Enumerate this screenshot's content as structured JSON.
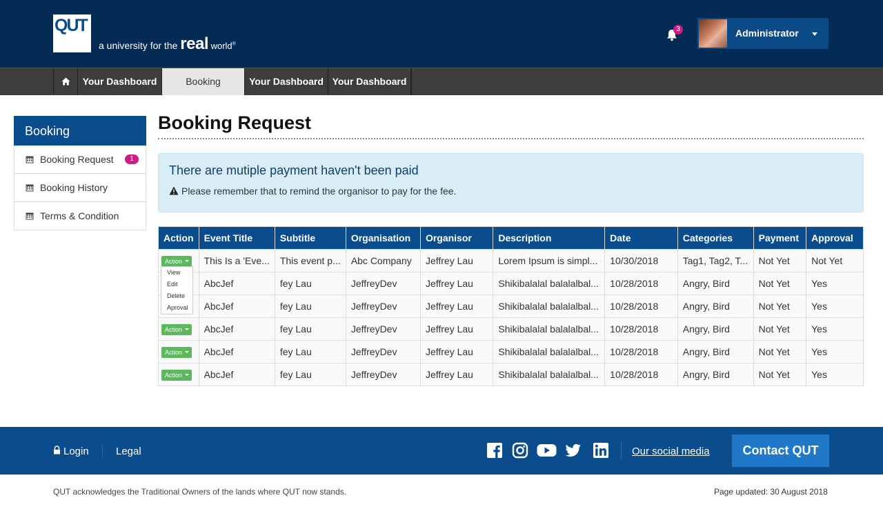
{
  "header": {
    "logo_text": "QUT",
    "tagline_prefix": "a university for the ",
    "tagline_real": "real",
    "tagline_world": " world",
    "tagline_reg": "®",
    "notifications_count": "3",
    "user_name": "Administrator"
  },
  "nav": {
    "items": [
      {
        "label": "Your Dashboard"
      },
      {
        "label": "Booking",
        "active": true
      },
      {
        "label": "Your Dashboard"
      },
      {
        "label": "Your Dashboard"
      }
    ]
  },
  "sidebar": {
    "title": "Booking",
    "items": [
      {
        "label": "Booking Request",
        "badge": "1"
      },
      {
        "label": "Booking History"
      },
      {
        "label": "Terms & Condition"
      }
    ]
  },
  "main": {
    "title": "Booking Request",
    "alert": {
      "heading": "There are mutiple payment haven't been paid",
      "message": "Please remember that to remind the organisor to pay for the fee."
    },
    "table": {
      "columns": [
        "Action",
        "Event Title",
        "Subtitle",
        "Organisation",
        "Organisor",
        "Description",
        "Date",
        "Categories",
        "Payment",
        "Approval"
      ],
      "action_label": "Action",
      "rows": [
        [
          "This Is a 'Eve...",
          "This event p...",
          "Abc Company",
          "Jeffrey Lau",
          "Lorem Ipsum is simpl...",
          "10/30/2018",
          "Tag1, Tag2, T...",
          "Not Yet",
          "Not Yet"
        ],
        [
          "AbcJef",
          "fey Lau",
          "JeffreyDev",
          "Jeffrey Lau",
          "Shikibalalal balalalbal...",
          "10/28/2018",
          "Angry, Bird",
          "Not Yet",
          "Yes"
        ],
        [
          "AbcJef",
          "fey Lau",
          "JeffreyDev",
          "Jeffrey Lau",
          "Shikibalalal balalalbal...",
          "10/28/2018",
          "Angry, Bird",
          "Not Yet",
          "Yes"
        ],
        [
          "AbcJef",
          "fey Lau",
          "JeffreyDev",
          "Jeffrey Lau",
          "Shikibalalal balalalbal...",
          "10/28/2018",
          "Angry, Bird",
          "Not Yet",
          "Yes"
        ],
        [
          "AbcJef",
          "fey Lau",
          "JeffreyDev",
          "Jeffrey Lau",
          "Shikibalalal balalalbal...",
          "10/28/2018",
          "Angry, Bird",
          "Not Yet",
          "Yes"
        ],
        [
          "AbcJef",
          "fey Lau",
          "JeffreyDev",
          "Jeffrey Lau",
          "Shikibalalal balalalbal...",
          "10/28/2018",
          "Angry, Bird",
          "Not Yet",
          "Yes"
        ]
      ]
    },
    "action_menu": [
      "View",
      "Edit",
      "Delete",
      "Aproval"
    ]
  },
  "footer": {
    "login": "Login",
    "legal": "Legal",
    "social_icons": [
      "facebook-icon",
      "instagram-icon",
      "youtube-icon",
      "twitter-icon",
      "linkedin-icon"
    ],
    "social_link": "Our social media",
    "contact": "Contact QUT",
    "acknowledgement": "QUT acknowledges the Traditional Owners of the lands where QUT now stands.",
    "updated": "Page updated: 30 August 2018"
  }
}
